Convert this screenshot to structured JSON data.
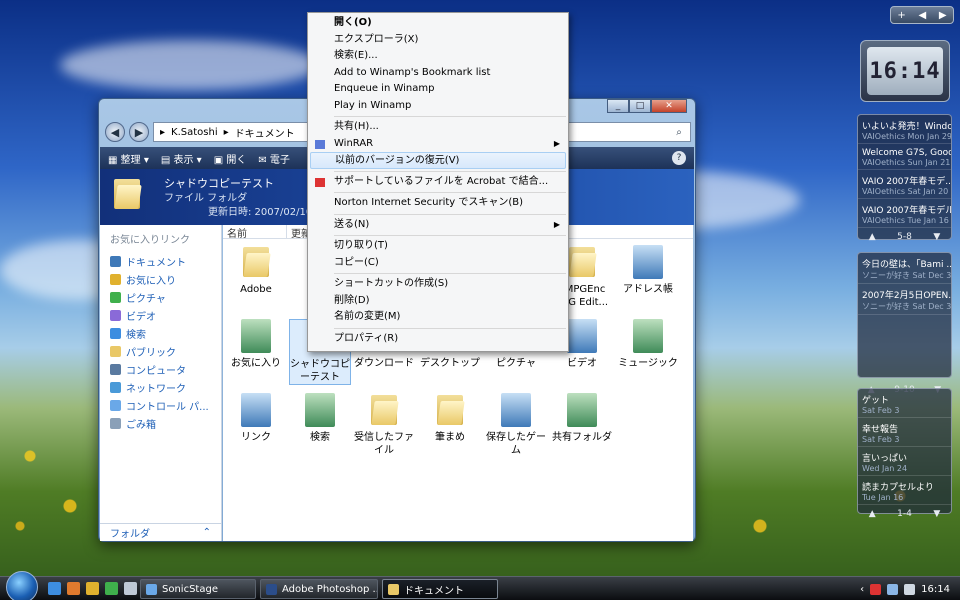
{
  "explorer": {
    "breadcrumb": [
      "K.Satoshi",
      "ドキュメント"
    ],
    "toolbar": {
      "organize": "整理",
      "views": "表示",
      "open": "開く",
      "email": "電子"
    },
    "header": {
      "title": "シャドウコピーテスト",
      "subtitle": "ファイル フォルダ",
      "modified": "更新日時: 2007/02/10 1"
    },
    "nav_heading": "お気に入りリンク",
    "nav_links": [
      "ドキュメント",
      "お気に入り",
      "ピクチャ",
      "ビデオ",
      "検索",
      "パブリック",
      "コンピュータ",
      "ネットワーク",
      "コントロール パ...",
      "ごみ箱"
    ],
    "nav_folder_bar": "フォルダ",
    "columns": [
      "名前",
      "更新"
    ],
    "items": [
      {
        "label": "Adobe",
        "type": "folder"
      },
      {
        "label": "B",
        "type": "folder"
      },
      {
        "label": "TMPGEnc\nPEG Edit...",
        "type": "folder"
      },
      {
        "label": "アドレス帳",
        "type": "special"
      },
      {
        "label": "お気に入り",
        "type": "special"
      },
      {
        "label": "シャドウコピーテスト",
        "type": "folder"
      },
      {
        "label": "ダウンロード",
        "type": "folder"
      },
      {
        "label": "デスクトップ",
        "type": "folder"
      },
      {
        "label": "ピクチャ",
        "type": "folder"
      },
      {
        "label": "ビデオ",
        "type": "special"
      },
      {
        "label": "ミュージック",
        "type": "special"
      },
      {
        "label": "リンク",
        "type": "special"
      },
      {
        "label": "検索",
        "type": "special"
      },
      {
        "label": "受信したファイル",
        "type": "folder"
      },
      {
        "label": "筆まめ",
        "type": "folder"
      },
      {
        "label": "保存したゲーム",
        "type": "special"
      },
      {
        "label": "共有フォルダ",
        "type": "special"
      }
    ]
  },
  "context_menu": {
    "items": [
      {
        "label": "開く(O)",
        "bold": true
      },
      {
        "label": "エクスプローラ(X)"
      },
      {
        "label": "検索(E)..."
      },
      {
        "label": "Add to Winamp's Bookmark list"
      },
      {
        "label": "Enqueue in Winamp"
      },
      {
        "label": "Play in Winamp"
      },
      {
        "sep": true
      },
      {
        "label": "共有(H)..."
      },
      {
        "label": "WinRAR",
        "submenu": true,
        "icon": true
      },
      {
        "label": "以前のバージョンの復元(V)",
        "highlight": true
      },
      {
        "sep": true
      },
      {
        "label": "サポートしているファイルを Acrobat で結合...",
        "icon": true
      },
      {
        "sep": true
      },
      {
        "label": "Norton Internet Security でスキャン(B)"
      },
      {
        "sep": true
      },
      {
        "label": "送る(N)",
        "submenu": true
      },
      {
        "sep": true
      },
      {
        "label": "切り取り(T)"
      },
      {
        "label": "コピー(C)"
      },
      {
        "sep": true
      },
      {
        "label": "ショートカットの作成(S)"
      },
      {
        "label": "削除(D)"
      },
      {
        "label": "名前の変更(M)"
      },
      {
        "sep": true
      },
      {
        "label": "プロパティ(R)"
      }
    ]
  },
  "sidebar": {
    "clock": "16:14",
    "feed1": {
      "items": [
        {
          "title": "いよいよ発売！Windo...",
          "meta": "VAIOethics Mon Jan 29"
        },
        {
          "title": "Welcome G7S, Good ...",
          "meta": "VAIOethics Sun Jan 21"
        },
        {
          "title": "VAIO 2007年春モデ...",
          "meta": "VAIOethics Sat Jan 20"
        },
        {
          "title": "VAIO 2007年春モデル",
          "meta": "VAIOethics Tue Jan 16"
        }
      ],
      "pager": "5-8"
    },
    "feed2": {
      "items": [
        {
          "title": "今日の壁は、「Bami ...",
          "meta": "ソニーが好き Sat Dec 30"
        },
        {
          "title": "2007年2月5日OPEN...",
          "meta": "ソニーが好き Sat Dec 30"
        }
      ],
      "pager": "9-10"
    },
    "feed3": {
      "items": [
        {
          "title": "ゲット",
          "meta": "Sat Feb 3"
        },
        {
          "title": "幸せ報告",
          "meta": "Sat Feb 3"
        },
        {
          "title": "言いっぱい",
          "meta": "Wed Jan 24"
        },
        {
          "title": "読まカプセルより",
          "meta": "Tue Jan 16"
        }
      ],
      "pager": "1-4"
    }
  },
  "taskbar": {
    "buttons": [
      "SonicStage",
      "Adobe Photoshop ...",
      "ドキュメント"
    ],
    "time": "16:14"
  }
}
